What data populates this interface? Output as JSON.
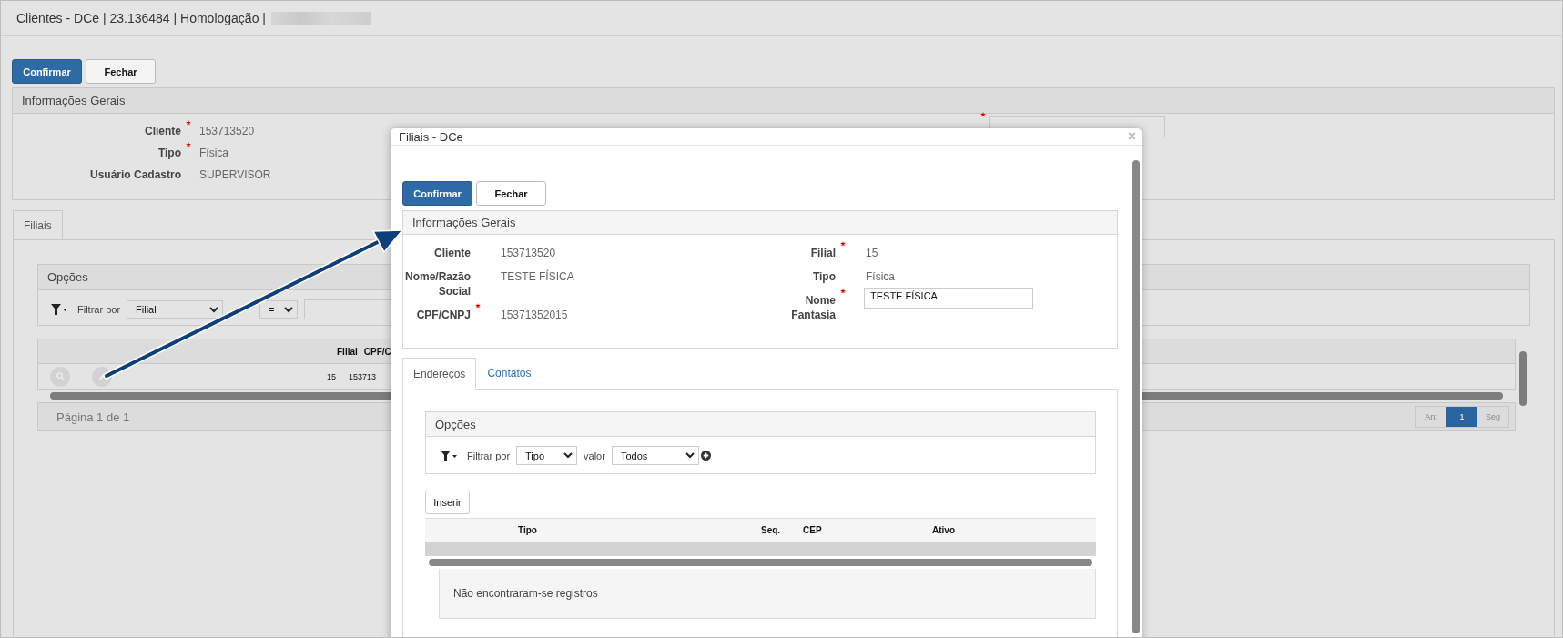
{
  "window": {
    "title": "Clientes - DCe | 23.136484 | Homologação |"
  },
  "toolbar": {
    "buttons": [
      {
        "label": "Confirmar",
        "kind": "primary"
      },
      {
        "label": "Fechar",
        "kind": "default"
      }
    ]
  },
  "general_info": {
    "title": "Informações Gerais",
    "fields": [
      {
        "label": "Cliente",
        "value": "153713520",
        "required": true
      },
      {
        "label": "Tipo",
        "value": "Física",
        "required": true
      },
      {
        "label": "Usuário Cadastro",
        "value": "SUPERVISOR",
        "required": false
      }
    ],
    "side_field": {
      "required": true
    }
  },
  "tabs": [
    {
      "label": "Filiais",
      "selected": true
    }
  ],
  "options": {
    "title": "Opções",
    "filter_label": "Filtrar por",
    "filter_field": "Filial",
    "operator": "="
  },
  "grid": {
    "columns": [
      "Filial",
      "CPF/C"
    ],
    "rows": [
      {
        "cells": [
          "15",
          "153713"
        ]
      }
    ],
    "page_info": "Página 1 de 1",
    "pagination": [
      {
        "label": "Ant",
        "selected": false
      },
      {
        "label": "1",
        "selected": true
      },
      {
        "label": "Seg",
        "selected": false
      }
    ]
  },
  "dialog": {
    "title": "Filiais - DCe",
    "close": "×",
    "buttons": [
      {
        "label": "Confirmar",
        "kind": "primary"
      },
      {
        "label": "Fechar",
        "kind": "default"
      }
    ],
    "info_title": "Informações Gerais",
    "left_fields": [
      {
        "label": "Cliente",
        "value": "153713520",
        "required": false,
        "kind": "text"
      },
      {
        "label": "Nome/Razão Social",
        "value": "TESTE FÍSICA",
        "required": false,
        "kind": "text"
      },
      {
        "label": "CPF/CNPJ",
        "value": "15371352015",
        "required": true,
        "kind": "text"
      }
    ],
    "right_fields": [
      {
        "label": "Filial",
        "value": "15",
        "required": true,
        "kind": "text"
      },
      {
        "label": "Tipo",
        "value": "Física",
        "required": false,
        "kind": "text"
      },
      {
        "label": "Nome Fantasia",
        "value": "TESTE FÍSICA",
        "required": true,
        "kind": "input"
      }
    ],
    "tabs": [
      {
        "label": "Endereços",
        "selected": true
      },
      {
        "label": "Contatos",
        "selected": false
      }
    ],
    "options": {
      "title": "Opções",
      "filter_label": "Filtrar por",
      "filter_field": "Tipo",
      "value_label": "valor",
      "value": "Todos"
    },
    "insert_button": "Inserir",
    "grid": {
      "columns": [
        "Tipo",
        "Seq.",
        "CEP",
        "Ativo"
      ],
      "empty_message": "Não encontraram-se registros"
    }
  }
}
